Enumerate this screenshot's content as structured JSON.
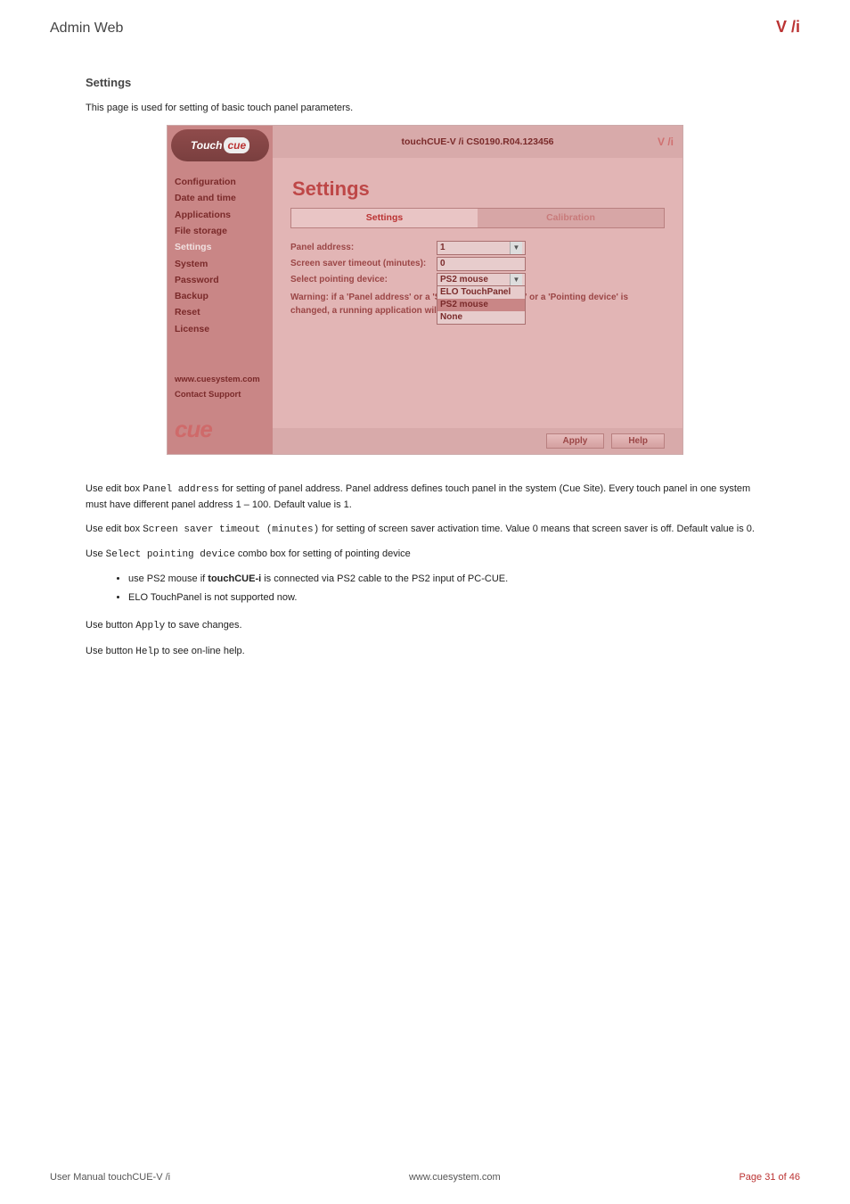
{
  "doc": {
    "header_title": "Admin Web",
    "header_version": "V /i",
    "footer_left": "User Manual touchCUE-V /i",
    "footer_center": "www.cuesystem.com",
    "footer_right": "Page 31 of 46",
    "section_heading": "Settings",
    "p_intro": "This page is used for setting of basic touch panel parameters.",
    "p_panel_addr_1": "Use edit box ",
    "p_panel_addr_key": "Panel address",
    "p_panel_addr_2": " for setting of panel address. Panel address defines touch panel in the system (Cue Site). Every touch panel in one system must have different panel address 1 – 100. Default value is 1.",
    "p_screensaver_1": "Use edit box ",
    "p_screensaver_key": "Screen saver timeout (minutes)",
    "p_screensaver_2": " for setting of screen saver activation time. Value 0 means that screen saver is off. Default value is 0.",
    "p_pointing_1": "Use ",
    "p_pointing_key": "Select pointing device",
    "p_pointing_2": " combo box for setting of pointing device",
    "bullet_1_pre": "use PS2 mouse if ",
    "bullet_1_st": "touchCUE-i",
    "bullet_1_post": " is connected via PS2 cable to the PS2 input of PC-CUE.",
    "bullet_2": "ELO TouchPanel is not supported now.",
    "p_btn_apply_1": "Use button ",
    "p_btn_apply_key": "Apply",
    "p_btn_apply_2": " to save changes.",
    "p_btn_help_1": "Use button ",
    "p_btn_help_key": "Help",
    "p_btn_help_2": " to see on-line help."
  },
  "ss": {
    "logo_a": "Touch",
    "logo_b": "cue",
    "header_mid": "touchCUE-V /i   CS0190.R04.123456",
    "header_right": "V /i",
    "nav": {
      "items": [
        "Configuration",
        "Date and time",
        "Applications",
        "File storage",
        "Settings",
        "System",
        "Password",
        "Backup",
        "Reset",
        "License"
      ],
      "active_index": 4
    },
    "support": {
      "link": "www.cuesystem.com",
      "contact": "Contact Support"
    },
    "cue_logo": "cue",
    "heading": "Settings",
    "tabs": {
      "settings": "Settings",
      "calibration": "Calibration"
    },
    "form": {
      "panel_addr_label": "Panel address:",
      "panel_addr_value": "1",
      "screensaver_label": "Screen saver timeout (minutes):",
      "screensaver_value": "0",
      "pointing_label": "Select pointing device:",
      "pointing_value": "PS2 mouse",
      "dropdown_options": [
        "ELO TouchPanel",
        "PS2 mouse",
        "None"
      ],
      "warning": "Warning: if a 'Panel address' or a 'Screen saver timeout' or a 'Pointing device' is changed, a running application will None"
    },
    "buttons": {
      "apply": "Apply",
      "help": "Help"
    }
  }
}
